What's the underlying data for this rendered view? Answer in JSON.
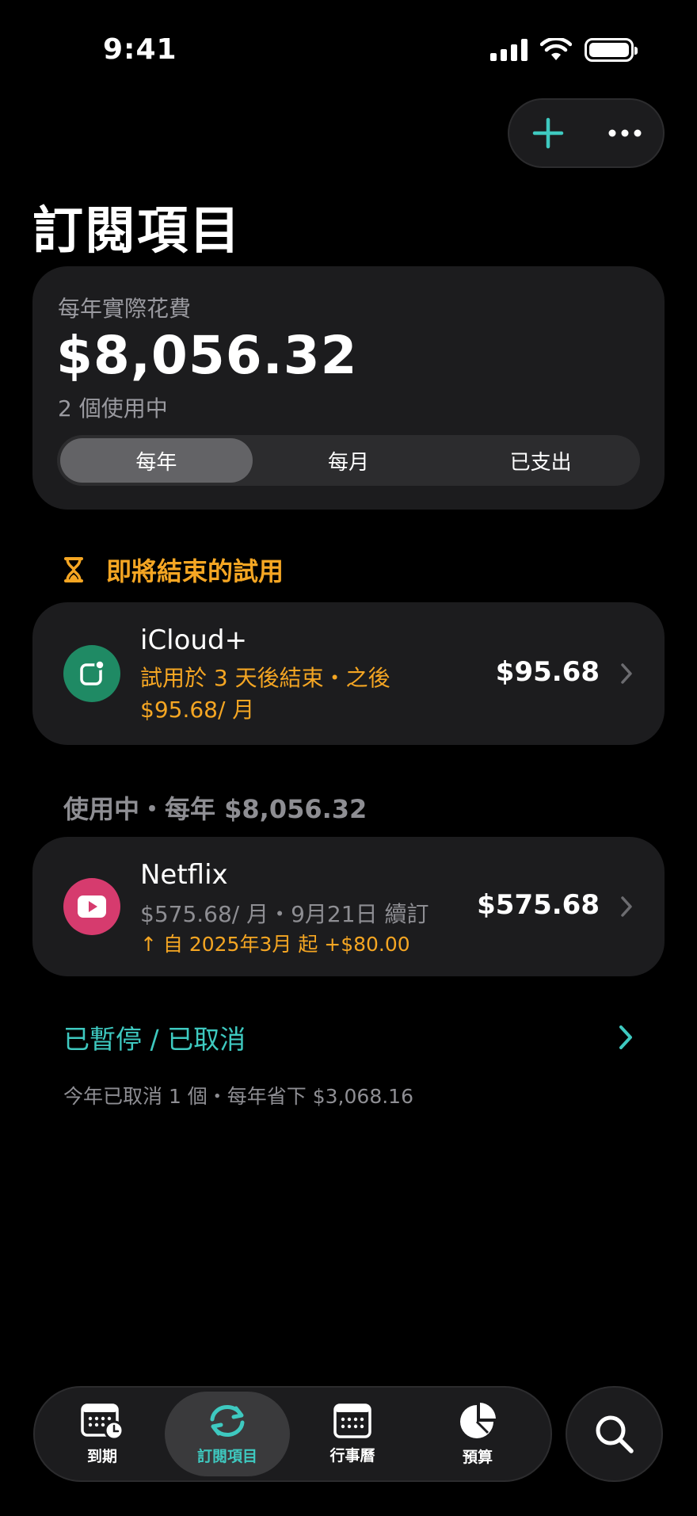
{
  "status_bar": {
    "time": "9:41"
  },
  "page": {
    "title": "訂閱項目"
  },
  "summary": {
    "label": "每年實際花費",
    "amount": "$8,056.32",
    "active_count": "2 個使用中",
    "segments": [
      "每年",
      "每月",
      "已支出"
    ],
    "selected_segment": "每年"
  },
  "trial_section": {
    "header": "即將結束的試用",
    "item": {
      "name": "iCloud+",
      "line1": "試用於 3 天後結束・之後",
      "line2": "$95.68/ 月",
      "price": "$95.68",
      "icon_color": "#1f8a64"
    }
  },
  "active_section": {
    "header": "使用中・每年 $8,056.32",
    "item": {
      "name": "Netflix",
      "line1": "$575.68/ 月・9月21日 續訂",
      "line2": "↑ 自 2025年3月 起 +$80.00",
      "price": "$575.68",
      "icon_color": "#d63b6e"
    }
  },
  "paused": {
    "label": "已暫停 / 已取消",
    "note": "今年已取消 1 個・每年省下 $3,068.16"
  },
  "tab_bar": {
    "tabs": [
      {
        "label": "到期",
        "icon": "calendar-clock-icon"
      },
      {
        "label": "訂閱項目",
        "icon": "refresh-icon"
      },
      {
        "label": "行事曆",
        "icon": "calendar-icon"
      },
      {
        "label": "預算",
        "icon": "pie-chart-icon"
      }
    ],
    "active_tab": "訂閱項目"
  },
  "colors": {
    "accent": "#3ec9c0",
    "warning": "#f5a623",
    "card": "#1c1c1e"
  }
}
